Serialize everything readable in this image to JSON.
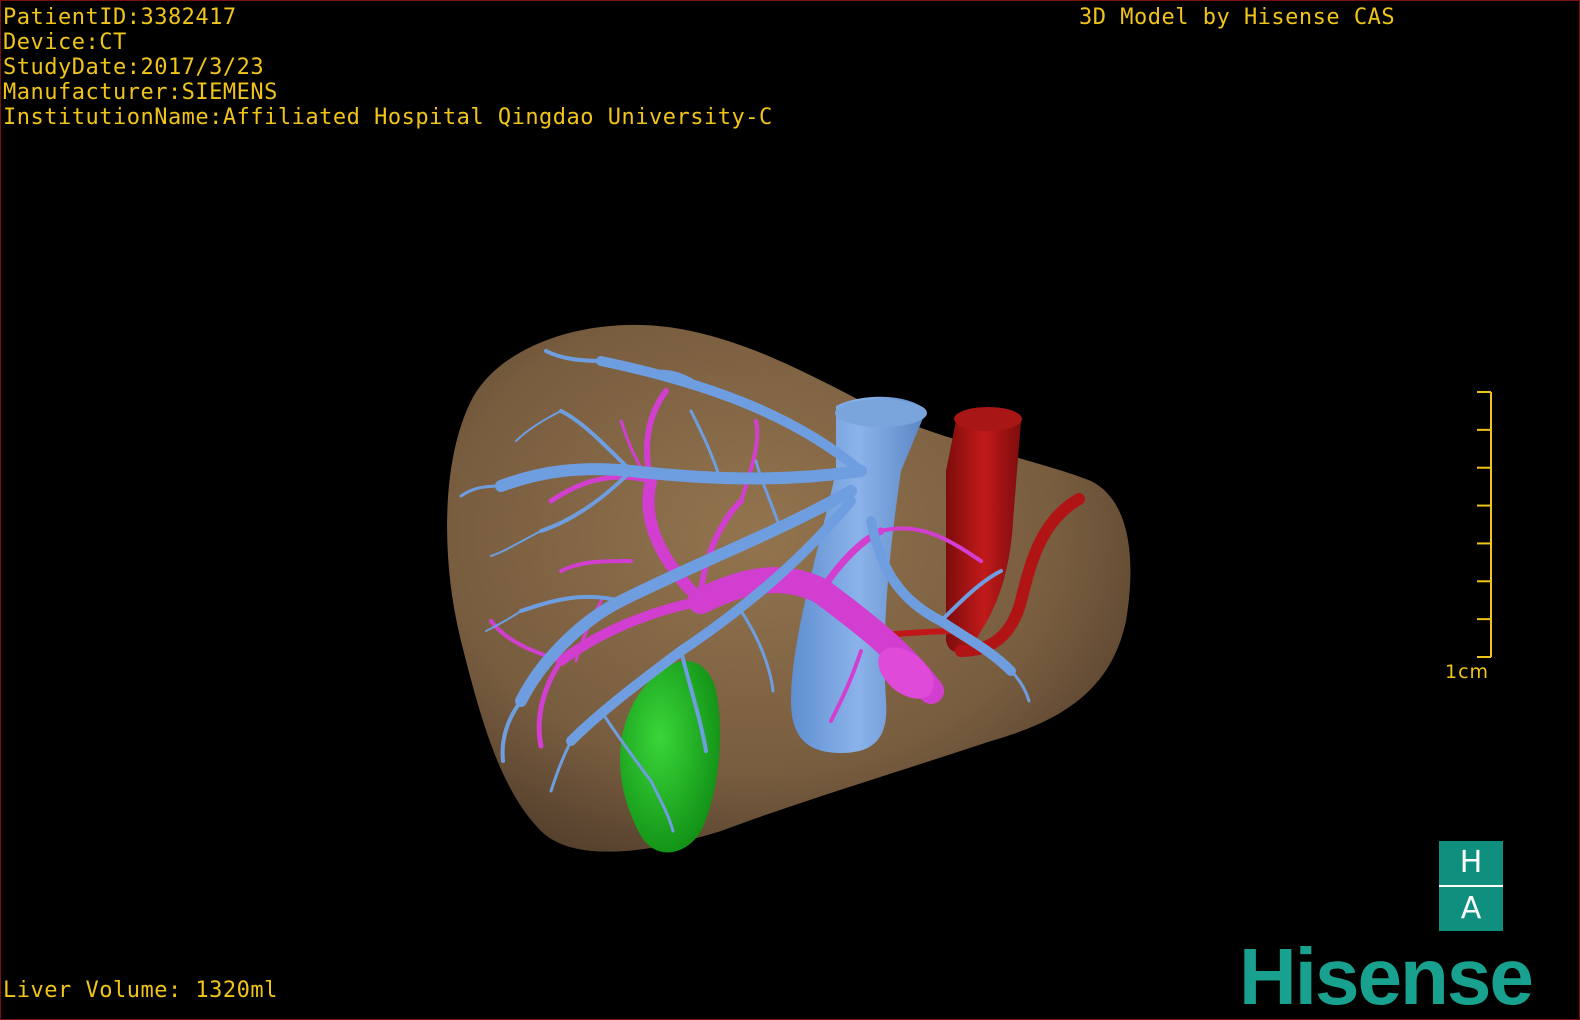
{
  "study_info": {
    "patient_id": "PatientID:3382417",
    "device": "Device:CT",
    "study_date": "StudyDate:2017/3/23",
    "manufacturer": "Manufacturer:SIEMENS",
    "institution": "InstitutionName:Affiliated Hospital Qingdao University-C"
  },
  "model_credit": "3D Model by Hisense CAS",
  "liver_volume": "Liver Volume: 1320ml",
  "scale": {
    "label": "1cm",
    "tick_count": 8
  },
  "logos": {
    "ha_top": "H",
    "ha_bottom": "A",
    "brand": "Hisense"
  },
  "colors": {
    "text": "#f0c419",
    "liver": "#8a6a45",
    "hepatic_vein": "#6f9ee0",
    "portal_vein": "#d23fd0",
    "artery": "#b11414",
    "gallbladder": "#17b31a",
    "brand": "#18a18e"
  }
}
